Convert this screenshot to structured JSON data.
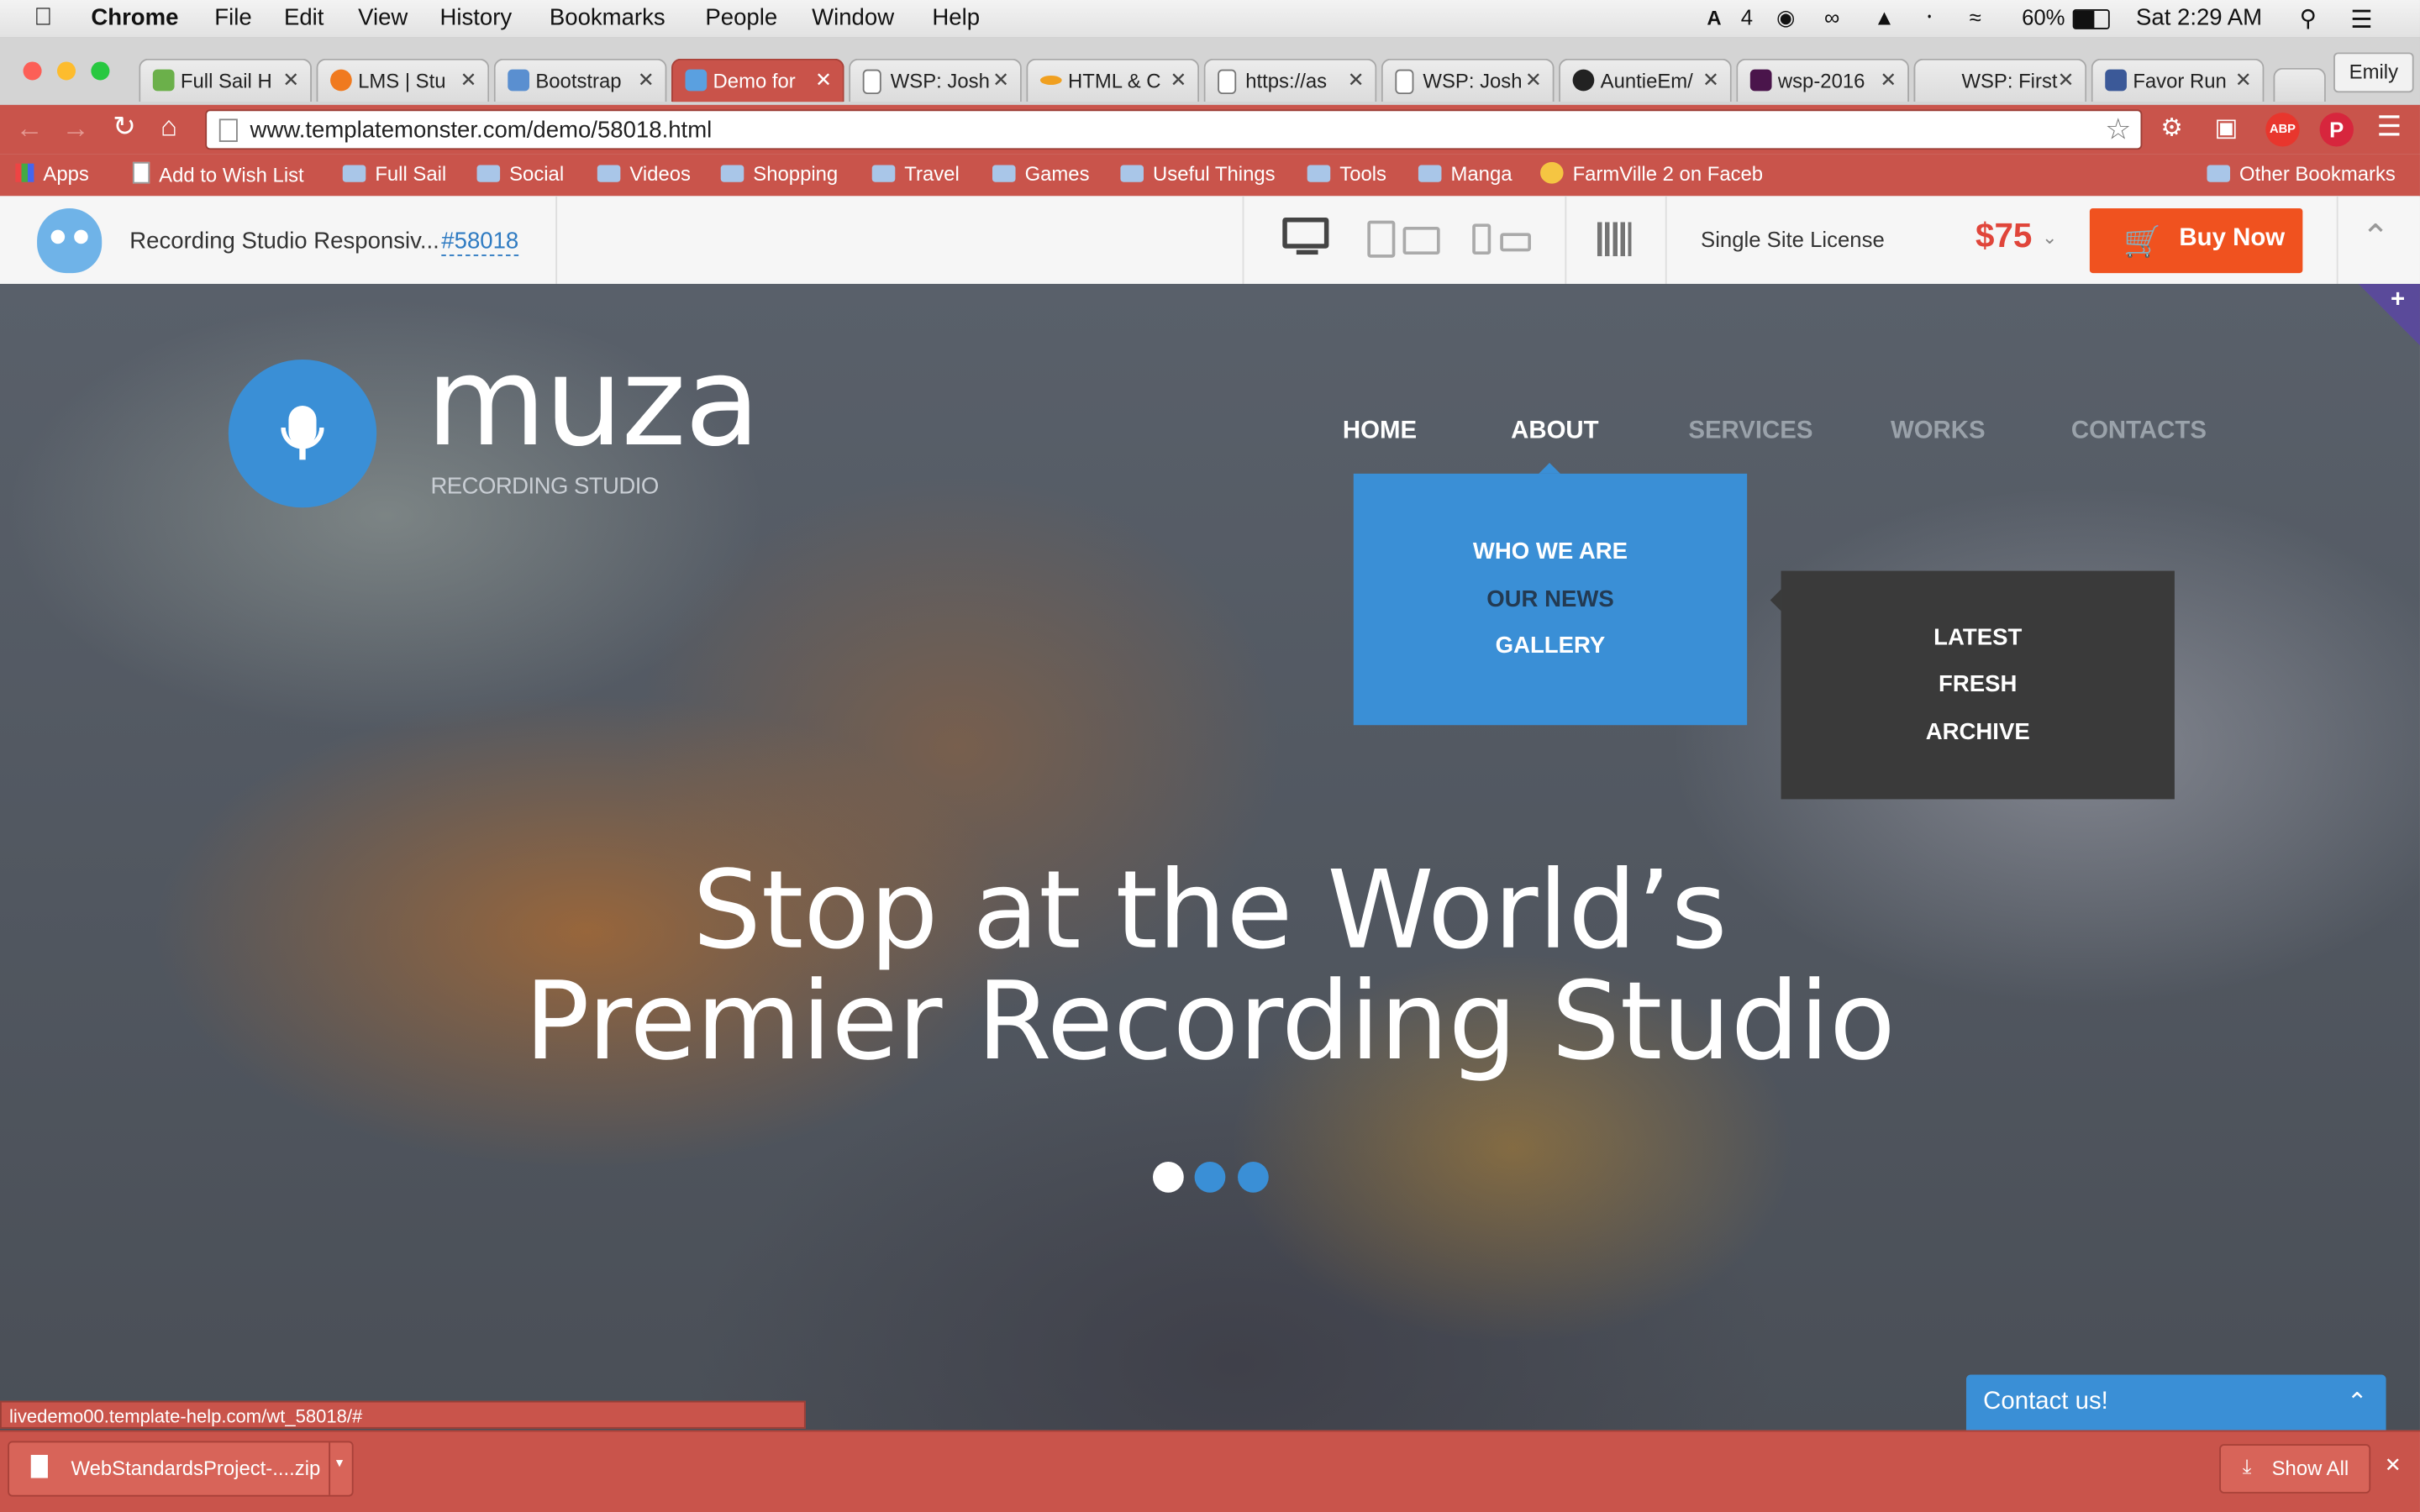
{
  "menubar": {
    "app_name": "Chrome",
    "items": [
      "File",
      "Edit",
      "View",
      "History",
      "Bookmarks",
      "People",
      "Window",
      "Help"
    ],
    "status": {
      "adobe_count": "4",
      "battery": "60%",
      "clock": "Sat 2:29 AM"
    }
  },
  "tabs": [
    {
      "label": "Full Sail H",
      "color": "#6bb04a"
    },
    {
      "label": "LMS | Stu",
      "color": "#f07a1f"
    },
    {
      "label": "Bootstrap",
      "color": "#5a8fd0"
    },
    {
      "label": "Demo for",
      "color": "#5aa0e0",
      "active": true
    },
    {
      "label": "WSP: Josh",
      "color": "#ffffff"
    },
    {
      "label": "HTML & C",
      "color": "#f0a020"
    },
    {
      "label": "https://as",
      "color": "#ffffff"
    },
    {
      "label": "WSP: Josh",
      "color": "#ffffff"
    },
    {
      "label": "AuntieEm/",
      "color": "#222222"
    },
    {
      "label": "wsp-2016",
      "color": "#4a154b"
    },
    {
      "label": "WSP: First",
      "color": "#ffffff"
    },
    {
      "label": "Favor Run",
      "color": "#3b5998"
    }
  ],
  "profile": {
    "name": "Emily"
  },
  "toolbar": {
    "url": "www.templatemonster.com/demo/58018.html"
  },
  "bookmarks": {
    "apps": "Apps",
    "items": [
      "Add to Wish List",
      "Full Sail",
      "Social",
      "Videos",
      "Shopping",
      "Travel",
      "Games",
      "Useful Things",
      "Tools",
      "Manga",
      "FarmVille 2 on Faceb"
    ],
    "other": "Other Bookmarks"
  },
  "tmbar": {
    "title": "Recording Studio Responsiv...",
    "id": "#58018",
    "license": "Single Site License",
    "price": "$75",
    "buy_label": "Buy Now"
  },
  "site": {
    "logo_word": "muza",
    "logo_sub": "RECORDING STUDIO",
    "nav": [
      "HOME",
      "ABOUT",
      "SERVICES",
      "WORKS",
      "CONTACTS"
    ],
    "about_menu": [
      "WHO WE ARE",
      "OUR NEWS",
      "GALLERY"
    ],
    "news_submenu": [
      "LATEST",
      "FRESH",
      "ARCHIVE"
    ],
    "headline_line1": "Stop at the World’s",
    "headline_line2": "Premier Recording Studio",
    "contact_label": "Contact us!",
    "brand_color": "#3a8fd6"
  },
  "statusbar": {
    "url": "livedemo00.template-help.com/wt_58018/#"
  },
  "downloads": {
    "file": "WebStandardsProject-....zip",
    "show_all": "Show All"
  }
}
